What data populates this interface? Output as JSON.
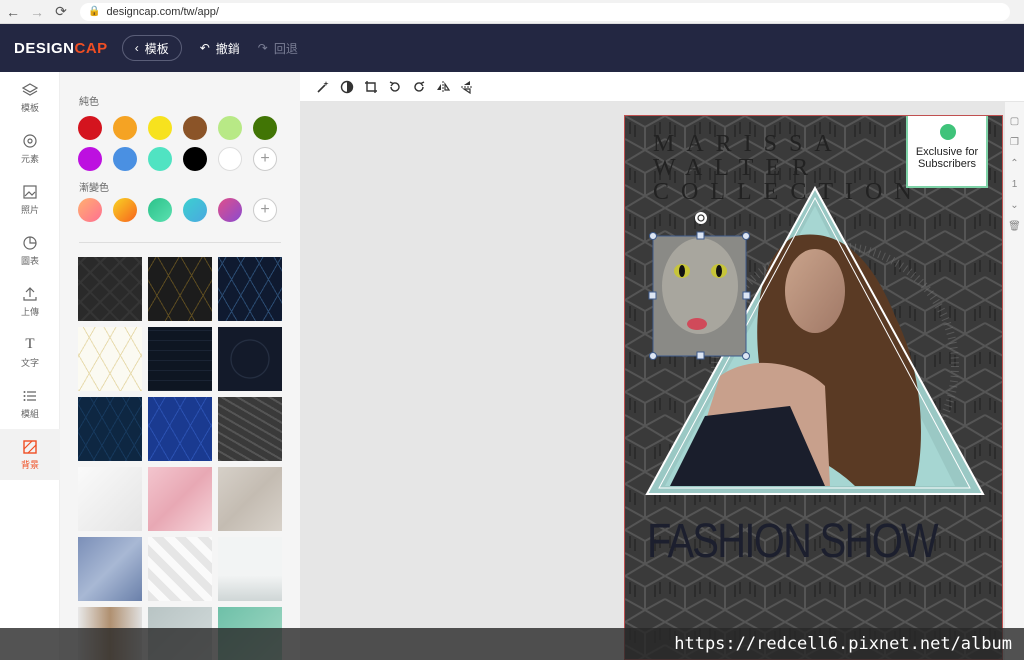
{
  "browser": {
    "url": "designcap.com/tw/app/"
  },
  "app": {
    "logo_main": "DESIGN",
    "logo_accent": "CAP",
    "templates_label": "模板",
    "undo_label": "撤銷",
    "redo_label": "回退"
  },
  "rail": {
    "items": [
      {
        "label": "模板",
        "icon": "layers-icon"
      },
      {
        "label": "元素",
        "icon": "elements-icon"
      },
      {
        "label": "照片",
        "icon": "image-icon"
      },
      {
        "label": "圖表",
        "icon": "pie-chart-icon"
      },
      {
        "label": "上傳",
        "icon": "upload-icon"
      },
      {
        "label": "文字",
        "icon": "text-icon"
      },
      {
        "label": "模組",
        "icon": "list-icon"
      },
      {
        "label": "背景",
        "icon": "background-icon"
      }
    ]
  },
  "panel": {
    "solid_label": "純色",
    "gradient_label": "漸變色",
    "solid_colors": [
      "#d4141e",
      "#f5a323",
      "#f7e21e",
      "#8b5428",
      "#b8e986",
      "#417505",
      "#bd10e0",
      "#4a90e2",
      "#50e3c2",
      "#000000",
      "#ffffff"
    ],
    "gradient_colors": [
      "#ff8c80",
      "#f7931e",
      "#3ec8a0",
      "#3cd0d0",
      "#c050c0"
    ]
  },
  "poster": {
    "headline_lines": [
      "MARISSA",
      "WALTER",
      "COLLECTION"
    ],
    "title": "FASHION SHOW",
    "badge_text": "Exclusive for Subscribers"
  },
  "right_tools": {
    "page_number": "1"
  },
  "watermark": {
    "text": "https://redcell6.pixnet.net/album"
  }
}
